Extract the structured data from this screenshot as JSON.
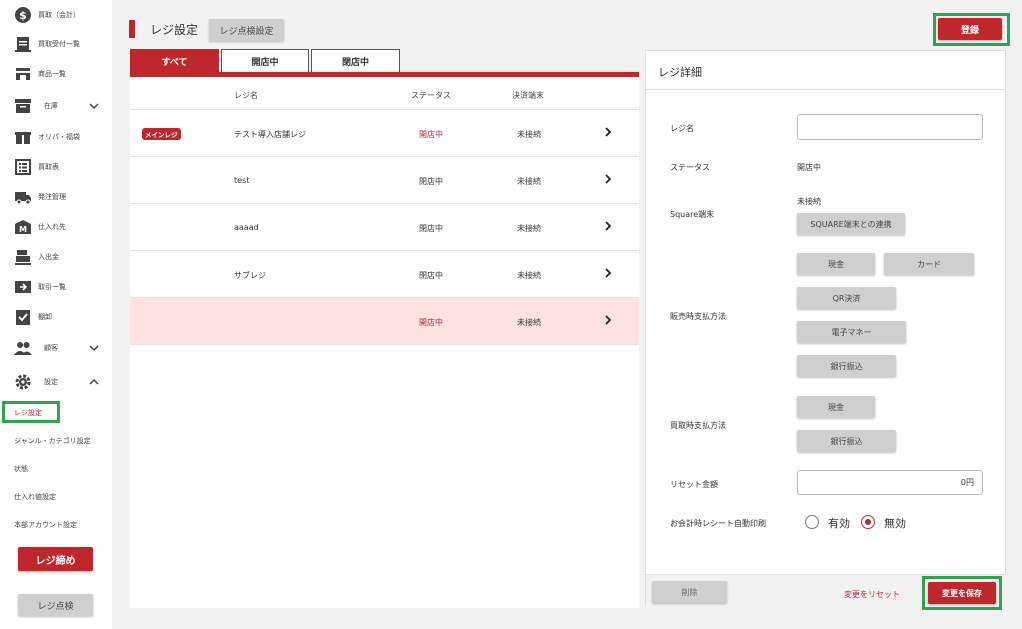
{
  "sidebar": {
    "items": [
      {
        "label": "買取（会計）",
        "icon": "dollar-icon"
      },
      {
        "label": "買取受付一覧",
        "icon": "clipboard-icon"
      },
      {
        "label": "商品一覧",
        "icon": "store-icon"
      },
      {
        "label": "在庫",
        "icon": "archive-icon"
      },
      {
        "label": "オリパ・福袋",
        "icon": "gift-icon"
      },
      {
        "label": "買取表",
        "icon": "list-icon"
      },
      {
        "label": "発注管理",
        "icon": "truck-icon"
      },
      {
        "label": "仕入れ先",
        "icon": "factory-icon"
      },
      {
        "label": "入出金",
        "icon": "register-icon"
      },
      {
        "label": "取引一覧",
        "icon": "transfer-icon"
      },
      {
        "label": "棚卸",
        "icon": "checklist-icon"
      },
      {
        "label": "顧客",
        "icon": "people-icon"
      },
      {
        "label": "設定",
        "icon": "gear-icon"
      }
    ],
    "sub_items": [
      "レジ設定",
      "ジャンル・カテゴリ設定",
      "状態",
      "仕入れ値設定",
      "本部アカウント設定"
    ],
    "close_register_label": "レジ締め",
    "check_register_label": "レジ点検"
  },
  "header": {
    "title": "レジ設定",
    "inspection_settings_label": "レジ点検設定",
    "register_label": "登録"
  },
  "tabs": [
    "すべて",
    "開店中",
    "閉店中"
  ],
  "table": {
    "columns": [
      "レジ名",
      "ステータス",
      "決済端末"
    ],
    "rows": [
      {
        "badge": "メインレジ",
        "name": "テスト導入店舗レジ",
        "status": "開店中",
        "terminal": "未接続"
      },
      {
        "badge": "",
        "name": "test",
        "status": "閉店中",
        "terminal": "未接続"
      },
      {
        "badge": "",
        "name": "aaaad",
        "status": "閉店中",
        "terminal": "未接続"
      },
      {
        "badge": "",
        "name": "サブレジ",
        "status": "閉店中",
        "terminal": "未接続"
      },
      {
        "badge": "",
        "name": "",
        "status": "開店中",
        "terminal": "未接続"
      }
    ]
  },
  "detail": {
    "title": "レジ詳細",
    "name_label": "レジ名",
    "name_value": "",
    "status_label": "ステータス",
    "status_value": "開店中",
    "square_label": "Square端末",
    "square_value": "未接続",
    "square_button": "SQUARE端末との連携",
    "sale_payment_label": "販売時支払方法",
    "sale_payments": [
      "現金",
      "カード",
      "QR決済",
      "電子マネー",
      "銀行振込"
    ],
    "purchase_payment_label": "買取時支払方法",
    "purchase_payments": [
      "現金",
      "銀行振込"
    ],
    "reset_amount_label": "リセット金額",
    "reset_amount_value": "0円",
    "receipt_label": "お会計時レシート自動印刷",
    "receipt_options": [
      "有効",
      "無効"
    ],
    "receipt_selected": "無効",
    "delete_label": "削除",
    "reset_changes_label": "変更をリセット",
    "save_label": "変更を保存"
  },
  "colors": {
    "accent": "#c0272d",
    "highlight": "#2ea44f",
    "selected_row": "#fde2e2"
  }
}
